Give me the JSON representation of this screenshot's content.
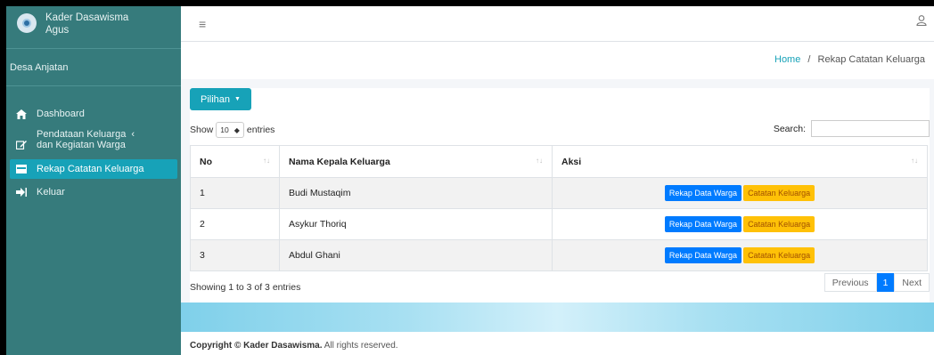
{
  "sidebar": {
    "brand": {
      "line1": "Kader Dasawisma",
      "line2": "Agus"
    },
    "user": "Desa Anjatan",
    "items": [
      {
        "label": "Dashboard",
        "icon": "home-icon"
      },
      {
        "label_line1": "Pendataan Keluarga",
        "label_line2": "dan Kegiatan Warga",
        "icon": "edit-icon",
        "chevron": "‹"
      },
      {
        "label": "Rekap Catatan Keluarga",
        "icon": "table-icon",
        "active": true
      },
      {
        "label": "Keluar",
        "icon": "sign-out-icon"
      }
    ]
  },
  "topbar": {
    "menu_icon": "≡",
    "user_icon": "⚲"
  },
  "breadcrumb": {
    "home": "Home",
    "separator": "/",
    "current": "Rekap Catatan Keluarga"
  },
  "controls": {
    "pilihan": "Pilihan",
    "show": "Show",
    "page_size": "10",
    "entries": "entries",
    "search_label": "Search:",
    "search_value": ""
  },
  "table": {
    "columns": [
      "No",
      "Nama Kepala Keluarga",
      "Aksi"
    ],
    "rows": [
      {
        "no": "1",
        "nama": "Budi Mustaqim"
      },
      {
        "no": "2",
        "nama": "Asykur Thoriq"
      },
      {
        "no": "3",
        "nama": "Abdul Ghani"
      }
    ],
    "action_primary": "Rekap Data Warga",
    "action_secondary": "Catatan Keluarga"
  },
  "pagination": {
    "info": "Showing 1 to 3 of 3 entries",
    "previous": "Previous",
    "current": "1",
    "next": "Next"
  },
  "footer": {
    "brand": "Copyright © Kader Dasawisma.",
    "rest": "All rights reserved."
  },
  "colors": {
    "sidebar": "#367b7c",
    "active": "#17a2b8",
    "primary": "#007bff",
    "warning": "#ffc107"
  }
}
